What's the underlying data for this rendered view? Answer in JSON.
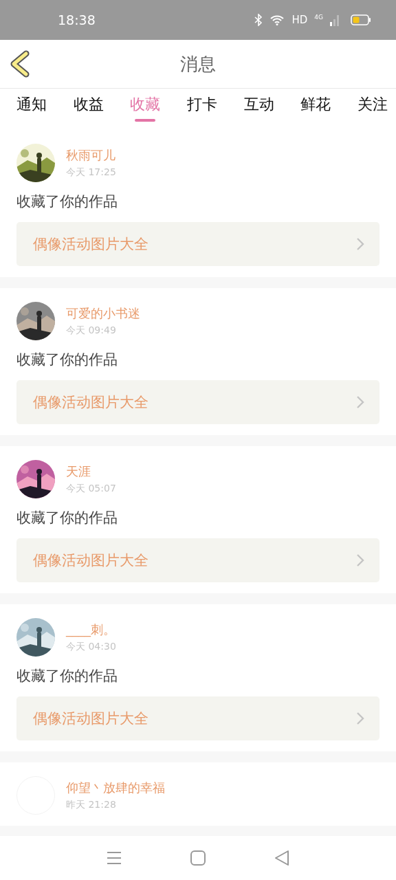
{
  "status_bar": {
    "time": "18:38",
    "network": "HD",
    "cellular": "4G"
  },
  "header": {
    "title": "消息"
  },
  "tabs": [
    {
      "label": "通知",
      "selected": false
    },
    {
      "label": "收益",
      "selected": false
    },
    {
      "label": "收藏",
      "selected": true
    },
    {
      "label": "打卡",
      "selected": false
    },
    {
      "label": "互动",
      "selected": false
    },
    {
      "label": "鲜花",
      "selected": false
    },
    {
      "label": "关注",
      "selected": false
    }
  ],
  "messages": [
    {
      "user": "秋雨可儿",
      "time": "今天 17:25",
      "avatar_loaded": true,
      "action": "收藏了你的作品",
      "work": "偶像活动图片大全"
    },
    {
      "user": "可爱的小书迷",
      "time": "今天 09:49",
      "avatar_loaded": true,
      "action": "收藏了你的作品",
      "work": "偶像活动图片大全"
    },
    {
      "user": "天涯",
      "time": "今天 05:07",
      "avatar_loaded": true,
      "action": "收藏了你的作品",
      "work": "偶像活动图片大全"
    },
    {
      "user": "____刺。",
      "time": "今天 04:30",
      "avatar_loaded": true,
      "action": "收藏了你的作品",
      "work": "偶像活动图片大全"
    },
    {
      "user": "仰望丶放肆的幸福",
      "time": "昨天 21:28",
      "avatar_loaded": false
    }
  ]
}
